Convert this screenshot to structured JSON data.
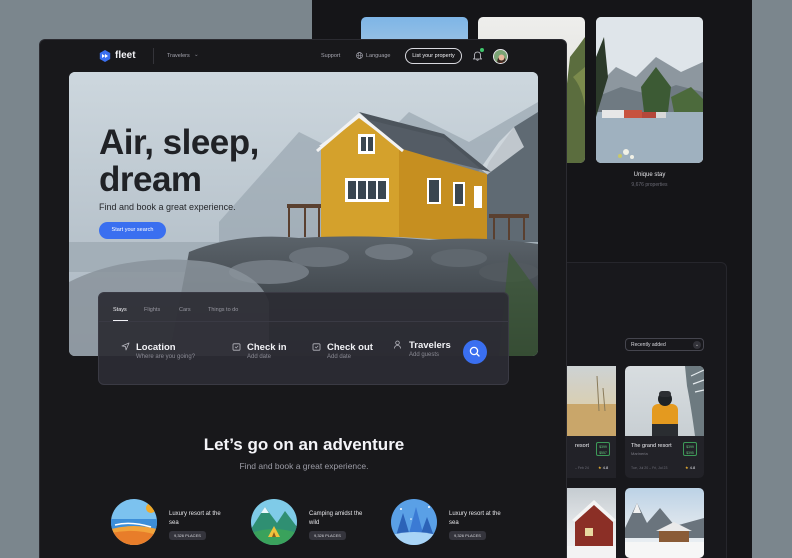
{
  "nav": {
    "brand": "fleet",
    "travelers": "Travelers",
    "support": "Support",
    "language": "Language",
    "list_property": "List your property"
  },
  "hero": {
    "title": "Air, sleep, dream",
    "subtitle": "Find and book a great experience.",
    "cta": "Start your search"
  },
  "search": {
    "tabs": [
      "Stays",
      "Flights",
      "Cars",
      "Things to do"
    ],
    "active_tab": "Stays",
    "fields": [
      {
        "label": "Location",
        "placeholder": "Where are you going?",
        "icon": "location-arrow-icon"
      },
      {
        "label": "Check in",
        "placeholder": "Add date",
        "icon": "calendar-icon"
      },
      {
        "label": "Check out",
        "placeholder": "Add date",
        "icon": "calendar-icon"
      },
      {
        "label": "Travelers",
        "placeholder": "Add guests",
        "icon": "user-icon"
      }
    ]
  },
  "adventure": {
    "title": "Let’s go on an adventure",
    "subtitle": "Find and book a great experience.",
    "categories": [
      {
        "name": "Luxury resort at the sea",
        "count": "9,326 PLACES"
      },
      {
        "name": "Camping amidst the wild",
        "count": "9,326 PLACES"
      },
      {
        "name": "Luxury resort at the sea",
        "count": "9,326 PLACES"
      }
    ]
  },
  "back_panel": {
    "unique_stay": {
      "title": "Unique stay",
      "count": "9,676 properties"
    },
    "sort": "Recently added",
    "listings": [
      {
        "title": "resort",
        "price": [
          "$399",
          "$557"
        ],
        "dates": "– Feb 24",
        "rating": "4.8"
      },
      {
        "title": "The grand resort",
        "location": "Marineria",
        "price": [
          "$399",
          "$395"
        ],
        "dates": "Tue, Jul 20 – Fri, Jul 23",
        "rating": "4.8"
      }
    ]
  },
  "colors": {
    "accent": "#3a6ff0",
    "background": "#18181b",
    "price_green": "#63c47c",
    "star": "#f0b532"
  }
}
